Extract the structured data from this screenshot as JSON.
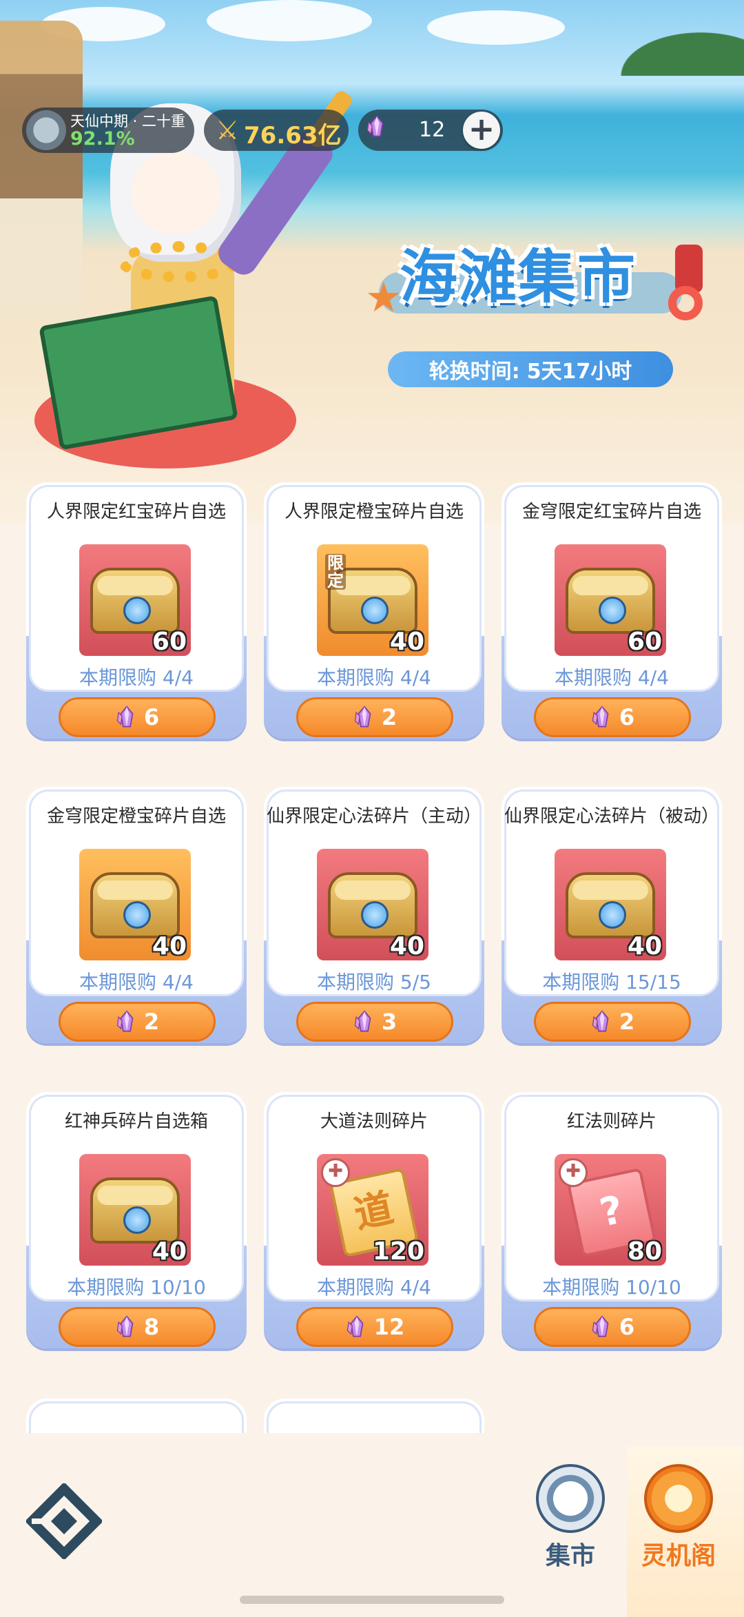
{
  "topbar": {
    "realm_name": "天仙中期 · 二十重",
    "realm_progress": "92.1%",
    "power_value": "76.63亿",
    "gem_count": "12",
    "plus_symbol": "+"
  },
  "banner": {
    "title": "海滩集市",
    "rotation_label": "轮换时间:",
    "rotation_value": "5天17小时"
  },
  "items": [
    {
      "name": "人界限定红宝碎片自选",
      "qty": "60",
      "limit": "本期限购 4/4",
      "price": "6",
      "thumb": "red",
      "art": "chest"
    },
    {
      "name": "人界限定橙宝碎片自选",
      "qty": "40",
      "limit": "本期限购 4/4",
      "price": "2",
      "thumb": "orange",
      "art": "chest",
      "tag": "限定"
    },
    {
      "name": "金穹限定红宝碎片自选",
      "qty": "60",
      "limit": "本期限购 4/4",
      "price": "6",
      "thumb": "red",
      "art": "chest"
    },
    {
      "name": "金穹限定橙宝碎片自选",
      "qty": "40",
      "limit": "本期限购 4/4",
      "price": "2",
      "thumb": "orange",
      "art": "chest"
    },
    {
      "name": "仙界限定心法碎片（主动）",
      "qty": "40",
      "limit": "本期限购 5/5",
      "price": "3",
      "thumb": "red",
      "art": "chest"
    },
    {
      "name": "仙界限定心法碎片（被动）",
      "qty": "40",
      "limit": "本期限购 15/15",
      "price": "2",
      "thumb": "red",
      "art": "chest"
    },
    {
      "name": "红神兵碎片自选箱",
      "qty": "40",
      "limit": "本期限购 10/10",
      "price": "8",
      "thumb": "red",
      "art": "chest"
    },
    {
      "name": "大道法则碎片",
      "qty": "120",
      "limit": "本期限购 4/4",
      "price": "12",
      "thumb": "red",
      "art": "doc",
      "glyph": "道"
    },
    {
      "name": "红法则碎片",
      "qty": "80",
      "limit": "本期限购 10/10",
      "price": "6",
      "thumb": "red",
      "art": "docq",
      "glyph": "?"
    }
  ],
  "nav": {
    "market_label": "集市",
    "lingji_label": "灵机阁"
  },
  "colors": {
    "accent_orange": "#f5892b",
    "limit_blue": "#6b97d8",
    "title_blue": "#2f8fe0"
  }
}
